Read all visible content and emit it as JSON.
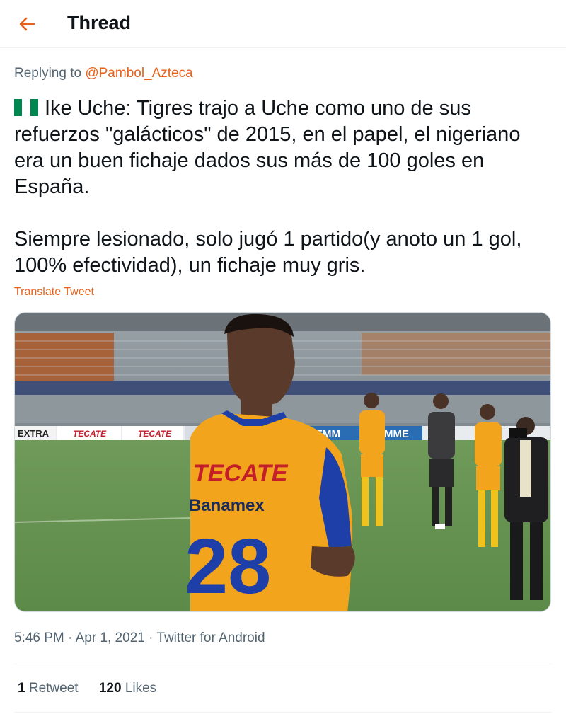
{
  "header": {
    "title": "Thread",
    "back_icon": "arrow-left-icon",
    "accent": "#e8621a"
  },
  "tweet": {
    "replying_prefix": "Replying to",
    "replying_handle": "@Pambol_Azteca",
    "flag": "nigeria-flag-emoji",
    "paragraph1": "Ike Uche: Tigres trajo a Uche como uno de sus\nrefuerzos \"galácticos\" de 2015, en el papel, el nigeriano\nera un buen fichaje dados sus más de 100 goles en\nEspaña.",
    "paragraph2": "Siempre lesionado, solo jugó 1 partido(y anoto un 1 gol,\n100% efectividad), un fichaje muy gris.",
    "translate": "Translate Tweet",
    "media": {
      "jersey_sponsor": "TECATE",
      "jersey_sponsor2": "Banamex",
      "jersey_number": "28",
      "board_ads": [
        "EXTRA",
        "TECATE",
        "TECATE",
        "EMM",
        "EMME"
      ]
    },
    "time": "5:46 PM",
    "date": "Apr 1, 2021",
    "source": "Twitter for Android",
    "separator": "·",
    "retweets_count": "1",
    "retweets_label": "Retweet",
    "likes_count": "120",
    "likes_label": "Likes"
  }
}
